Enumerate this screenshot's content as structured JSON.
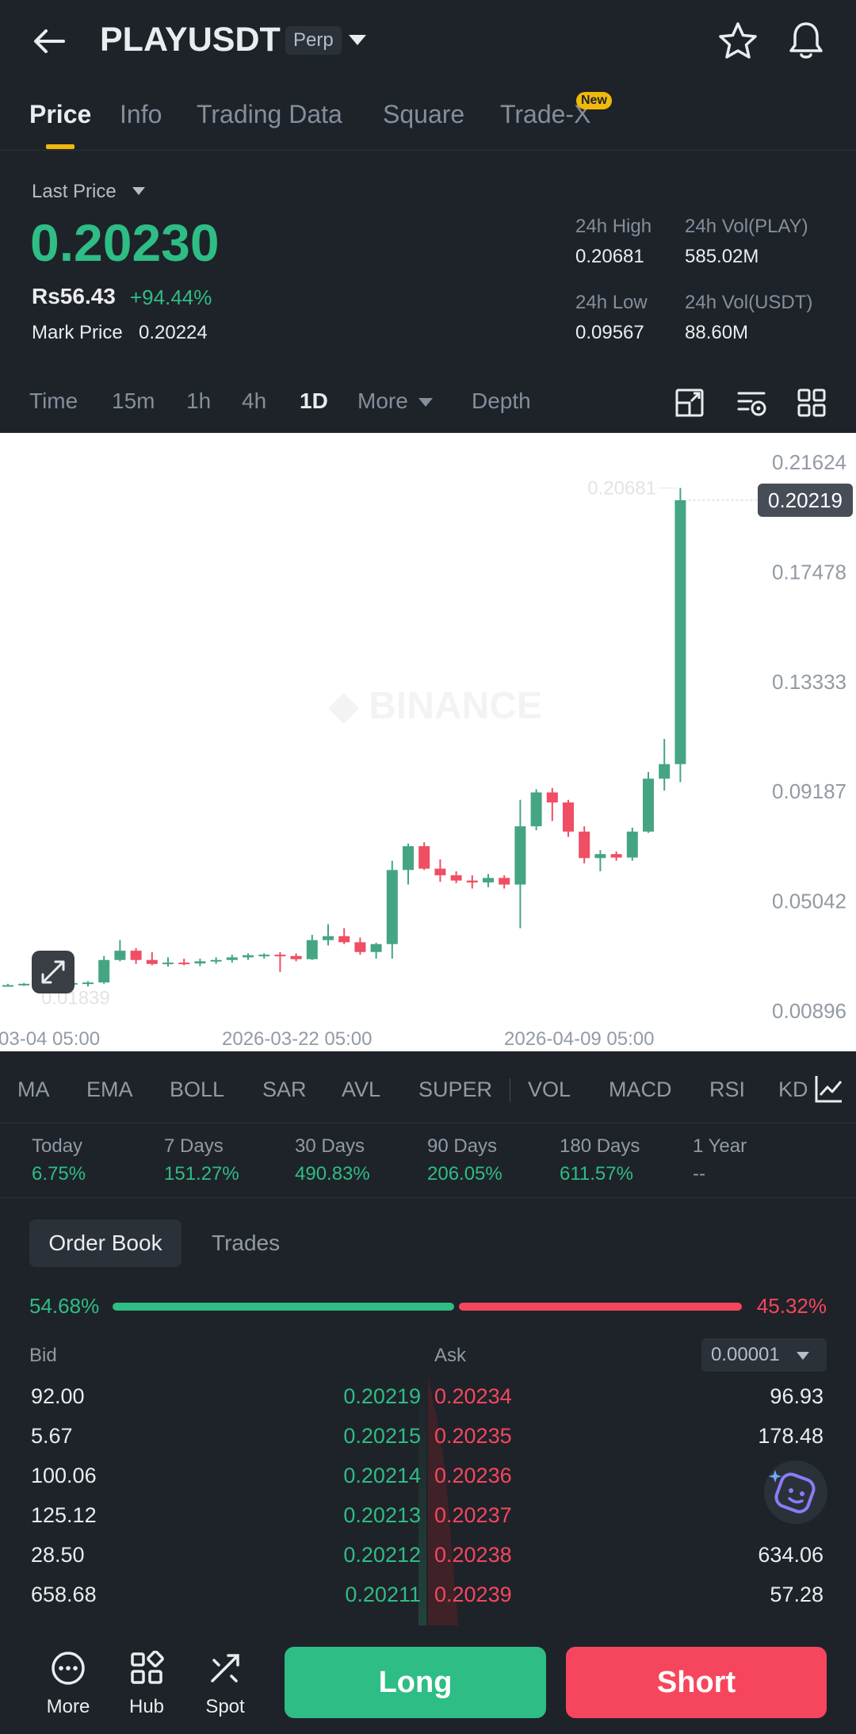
{
  "header": {
    "pair": "PLAYUSDT",
    "contract_type": "Perp",
    "icons": [
      "back-arrow-icon",
      "star-icon",
      "bell-icon"
    ]
  },
  "tabs": [
    {
      "label": "Price",
      "active": true
    },
    {
      "label": "Info"
    },
    {
      "label": "Trading Data"
    },
    {
      "label": "Square"
    },
    {
      "label": "Trade-X",
      "badge": "New"
    }
  ],
  "price": {
    "last_price_label": "Last Price",
    "last_price": "0.20230",
    "fiat": "Rs56.43",
    "change": "+94.44%",
    "mark_label": "Mark Price",
    "mark_value": "0.20224",
    "stats": {
      "high_label": "24h High",
      "high": "0.20681",
      "vol_play_label": "24h Vol(PLAY)",
      "vol_play": "585.02M",
      "low_label": "24h Low",
      "low": "0.09567",
      "vol_usdt_label": "24h Vol(USDT)",
      "vol_usdt": "88.60M"
    }
  },
  "timeframes": {
    "items": [
      "Time",
      "15m",
      "1h",
      "4h",
      "1D",
      "More",
      "Depth"
    ],
    "active": "1D"
  },
  "chart_data": {
    "type": "candlestick",
    "y_ticks": [
      "0.21624",
      "0.17478",
      "0.13333",
      "0.09187",
      "0.05042",
      "0.00896"
    ],
    "ylim": [
      0.00896,
      0.21624
    ],
    "x_ticks": [
      "03-04 05:00",
      "2026-03-22 05:00",
      "2026-04-09 05:00"
    ],
    "current_price_label": "0.20219",
    "high_marker": "0.20681",
    "low_marker": "0.01839",
    "candles": [
      {
        "o": 0.0184,
        "h": 0.0195,
        "l": 0.0184,
        "c": 0.019
      },
      {
        "o": 0.019,
        "h": 0.0198,
        "l": 0.0187,
        "c": 0.0195
      },
      {
        "o": 0.0195,
        "h": 0.02,
        "l": 0.0188,
        "c": 0.0192
      },
      {
        "o": 0.0192,
        "h": 0.02,
        "l": 0.0185,
        "c": 0.0196
      },
      {
        "o": 0.0196,
        "h": 0.0205,
        "l": 0.019,
        "c": 0.0198
      },
      {
        "o": 0.0198,
        "h": 0.0205,
        "l": 0.0185,
        "c": 0.02
      },
      {
        "o": 0.02,
        "h": 0.03,
        "l": 0.0195,
        "c": 0.0285
      },
      {
        "o": 0.0285,
        "h": 0.036,
        "l": 0.028,
        "c": 0.032
      },
      {
        "o": 0.032,
        "h": 0.033,
        "l": 0.027,
        "c": 0.0285
      },
      {
        "o": 0.0285,
        "h": 0.0315,
        "l": 0.0265,
        "c": 0.027
      },
      {
        "o": 0.027,
        "h": 0.0295,
        "l": 0.026,
        "c": 0.0275
      },
      {
        "o": 0.0275,
        "h": 0.029,
        "l": 0.0265,
        "c": 0.0272
      },
      {
        "o": 0.0272,
        "h": 0.029,
        "l": 0.0262,
        "c": 0.028
      },
      {
        "o": 0.028,
        "h": 0.0295,
        "l": 0.027,
        "c": 0.0285
      },
      {
        "o": 0.0285,
        "h": 0.0305,
        "l": 0.0275,
        "c": 0.0295
      },
      {
        "o": 0.0295,
        "h": 0.031,
        "l": 0.0285,
        "c": 0.0303
      },
      {
        "o": 0.0303,
        "h": 0.031,
        "l": 0.029,
        "c": 0.0305
      },
      {
        "o": 0.0305,
        "h": 0.0315,
        "l": 0.024,
        "c": 0.03
      },
      {
        "o": 0.03,
        "h": 0.031,
        "l": 0.028,
        "c": 0.0288
      },
      {
        "o": 0.0288,
        "h": 0.038,
        "l": 0.0285,
        "c": 0.036
      },
      {
        "o": 0.036,
        "h": 0.042,
        "l": 0.034,
        "c": 0.0375
      },
      {
        "o": 0.0375,
        "h": 0.0405,
        "l": 0.0345,
        "c": 0.0352
      },
      {
        "o": 0.0352,
        "h": 0.037,
        "l": 0.0305,
        "c": 0.0315
      },
      {
        "o": 0.0315,
        "h": 0.035,
        "l": 0.029,
        "c": 0.0345
      },
      {
        "o": 0.0345,
        "h": 0.066,
        "l": 0.029,
        "c": 0.0625
      },
      {
        "o": 0.0625,
        "h": 0.0725,
        "l": 0.057,
        "c": 0.0715
      },
      {
        "o": 0.0715,
        "h": 0.073,
        "l": 0.0625,
        "c": 0.063
      },
      {
        "o": 0.063,
        "h": 0.0665,
        "l": 0.058,
        "c": 0.0605
      },
      {
        "o": 0.0605,
        "h": 0.062,
        "l": 0.0575,
        "c": 0.0585
      },
      {
        "o": 0.0585,
        "h": 0.0605,
        "l": 0.0555,
        "c": 0.0578
      },
      {
        "o": 0.0578,
        "h": 0.061,
        "l": 0.056,
        "c": 0.0595
      },
      {
        "o": 0.0595,
        "h": 0.0605,
        "l": 0.0555,
        "c": 0.057
      },
      {
        "o": 0.057,
        "h": 0.089,
        "l": 0.0405,
        "c": 0.079
      },
      {
        "o": 0.079,
        "h": 0.093,
        "l": 0.0775,
        "c": 0.0918
      },
      {
        "o": 0.0918,
        "h": 0.0935,
        "l": 0.081,
        "c": 0.088
      },
      {
        "o": 0.088,
        "h": 0.089,
        "l": 0.075,
        "c": 0.077
      },
      {
        "o": 0.077,
        "h": 0.079,
        "l": 0.065,
        "c": 0.067
      },
      {
        "o": 0.067,
        "h": 0.07,
        "l": 0.062,
        "c": 0.0685
      },
      {
        "o": 0.0685,
        "h": 0.0695,
        "l": 0.066,
        "c": 0.0672
      },
      {
        "o": 0.0672,
        "h": 0.0785,
        "l": 0.066,
        "c": 0.077
      },
      {
        "o": 0.077,
        "h": 0.0995,
        "l": 0.0765,
        "c": 0.097
      },
      {
        "o": 0.097,
        "h": 0.112,
        "l": 0.0925,
        "c": 0.1025
      },
      {
        "o": 0.1025,
        "h": 0.2068,
        "l": 0.0957,
        "c": 0.2022
      }
    ]
  },
  "indicators": [
    "MA",
    "EMA",
    "BOLL",
    "SAR",
    "AVL",
    "SUPER",
    "VOL",
    "MACD",
    "RSI",
    "KD"
  ],
  "performance": [
    {
      "label": "Today",
      "value": "6.75%"
    },
    {
      "label": "7 Days",
      "value": "151.27%"
    },
    {
      "label": "30 Days",
      "value": "490.83%"
    },
    {
      "label": "90 Days",
      "value": "206.05%"
    },
    {
      "label": "180 Days",
      "value": "611.57%"
    },
    {
      "label": "1 Year",
      "value": "--"
    }
  ],
  "orderbook": {
    "tabs": [
      "Order Book",
      "Trades"
    ],
    "bid_ratio": "54.68%",
    "ask_ratio": "45.32%",
    "bid_ratio_value": 54.68,
    "bid_label": "Bid",
    "ask_label": "Ask",
    "precision": "0.00001",
    "rows": [
      {
        "bid_qty": "92.00",
        "bid_price": "0.20219",
        "ask_price": "0.20234",
        "ask_qty": "96.93"
      },
      {
        "bid_qty": "5.67",
        "bid_price": "0.20215",
        "ask_price": "0.20235",
        "ask_qty": "178.48"
      },
      {
        "bid_qty": "100.06",
        "bid_price": "0.20214",
        "ask_price": "0.20236",
        "ask_qty": ""
      },
      {
        "bid_qty": "125.12",
        "bid_price": "0.20213",
        "ask_price": "0.20237",
        "ask_qty": ""
      },
      {
        "bid_qty": "28.50",
        "bid_price": "0.20212",
        "ask_price": "0.20238",
        "ask_qty": "634.06"
      },
      {
        "bid_qty": "658.68",
        "bid_price": "0.20211",
        "ask_price": "0.20239",
        "ask_qty": "57.28"
      }
    ]
  },
  "bottom_nav": {
    "items": [
      {
        "label": "More",
        "icon": "more-dots-icon"
      },
      {
        "label": "Hub",
        "icon": "hub-grid-icon"
      },
      {
        "label": "Spot",
        "icon": "spot-arrows-icon"
      }
    ],
    "long": "Long",
    "short": "Short"
  },
  "colors": {
    "up": "#2ebd85",
    "down": "#f6465d",
    "accent": "#f0b90b",
    "background": "#1e2329"
  }
}
